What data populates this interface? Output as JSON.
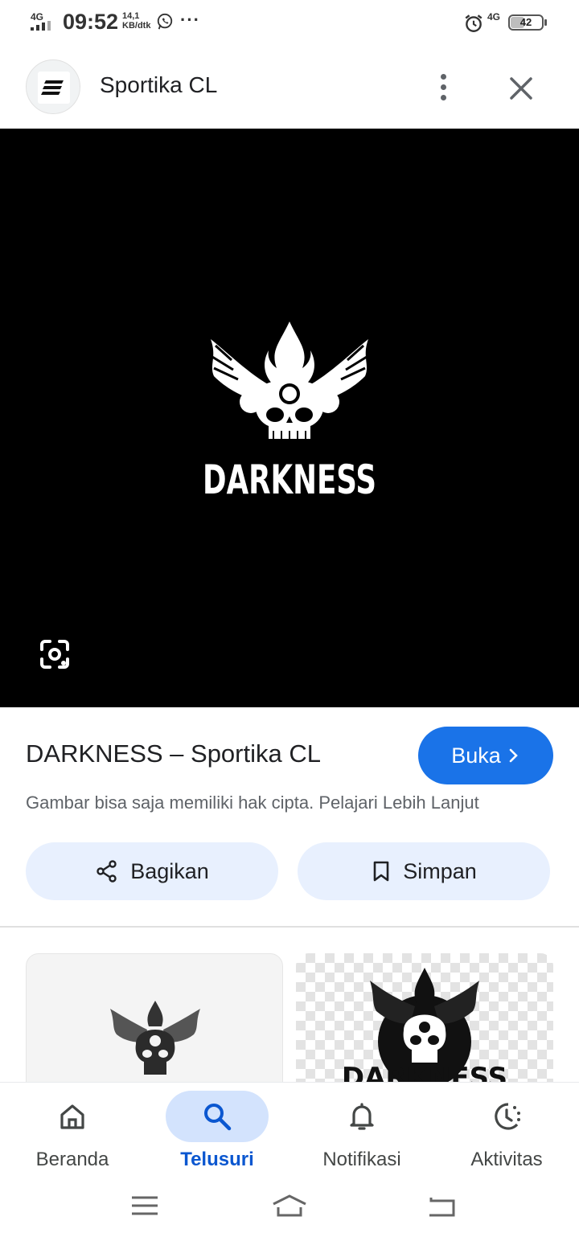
{
  "status_bar": {
    "network_left": "4G",
    "time": "09:52",
    "speed_value": "14,1",
    "speed_unit": "KB/dtk",
    "overflow": "···",
    "network_right": "4G",
    "battery_level": "42"
  },
  "header": {
    "site_name": "Sportika CL"
  },
  "hero": {
    "logo_text": "DARKNESS"
  },
  "result": {
    "title": "DARKNESS – Sportika CL",
    "open_button": "Buka",
    "copyright_notice": "Gambar bisa saja memiliki hak cipta. Pelajari Lebih Lanjut"
  },
  "actions": {
    "share_label": "Bagikan",
    "save_label": "Simpan"
  },
  "related": {
    "second_logo_text": "DARKNESS"
  },
  "bottom_nav": {
    "items": [
      {
        "label": "Beranda",
        "icon": "home-icon"
      },
      {
        "label": "Telusuri",
        "icon": "search-icon",
        "active": true
      },
      {
        "label": "Notifikasi",
        "icon": "bell-icon"
      },
      {
        "label": "Aktivitas",
        "icon": "activity-icon"
      }
    ]
  },
  "colors": {
    "accent": "#1a73e8",
    "active_nav_text": "#0b57d0",
    "active_nav_pill": "#d3e3fd",
    "action_pill": "#e8f0fe"
  }
}
